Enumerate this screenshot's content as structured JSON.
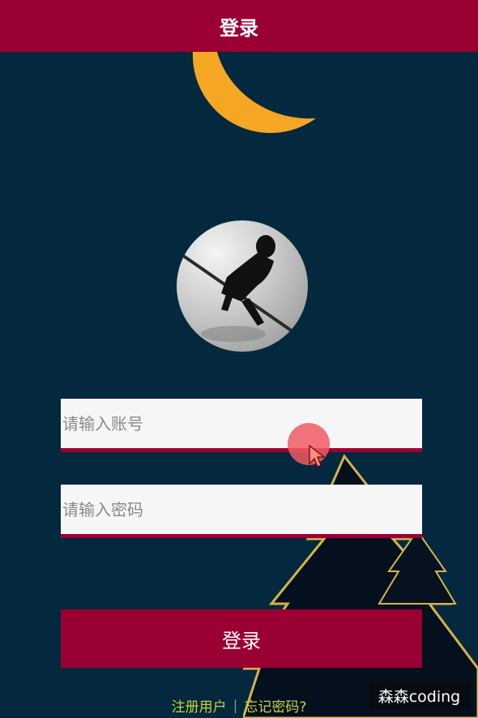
{
  "header": {
    "title": "登录"
  },
  "form": {
    "account_placeholder": "请输入账号",
    "password_placeholder": "请输入密码",
    "login_label": "登录"
  },
  "links": {
    "register_label": "注册用户",
    "separator": "|",
    "forgot_label": "忘记密码?"
  },
  "watermark": {
    "text": "森森coding"
  },
  "icons": [
    "moon-icon",
    "avatar-image",
    "tree-icon",
    "cursor-icon"
  ],
  "colors": {
    "background": "#04283d",
    "primary": "#9a0032",
    "moon": "#f5a623",
    "link": "#c7d23a",
    "tree_outline": "#d6b24a"
  }
}
